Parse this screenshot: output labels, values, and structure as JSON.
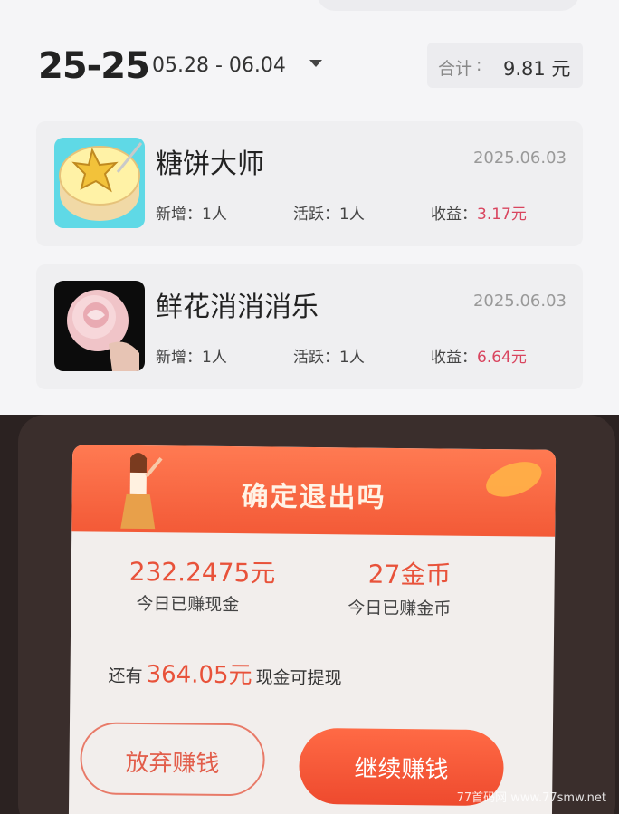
{
  "header": {
    "year_range": "25-25",
    "date_range": "05.28 - 06.04",
    "total_label": "合计",
    "total_sep": ":",
    "total_value": "9.81 元"
  },
  "apps": [
    {
      "name": "糖饼大师",
      "date": "2025.06.03",
      "new_users": "新增：1人",
      "active_users": "活跃：1人",
      "earnings_label": "收益：",
      "earnings_value": "3.17元",
      "icon": "sugar-cake-star-icon"
    },
    {
      "name": "鲜花消消消乐",
      "date": "2025.06.03",
      "new_users": "新增：1人",
      "active_users": "活跃：1人",
      "earnings_label": "收益：",
      "earnings_value": "6.64元",
      "icon": "rose-flower-icon"
    }
  ],
  "dialog": {
    "title": "确定退出吗",
    "cash_value": "232.2475元",
    "cash_label": "今日已赚现金",
    "coin_value": "27金币",
    "coin_label": "今日已赚金币",
    "withdraw_prefix": "还有",
    "withdraw_amount": "364.05元",
    "withdraw_suffix": "现金可提现",
    "quit_button": "放弃赚钱",
    "continue_button": "继续赚钱"
  },
  "watermark": "77首码网 www.77smw.net",
  "colors": {
    "accent": "#f35a37",
    "earnings": "#d9455f",
    "dialog_bg": "#f2eeec"
  }
}
